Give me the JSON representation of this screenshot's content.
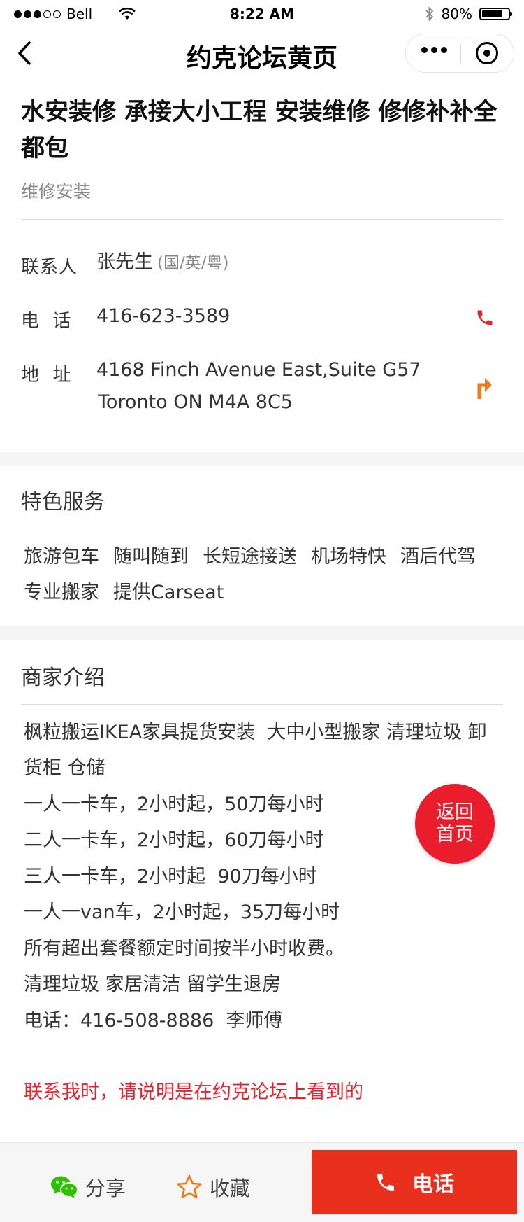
{
  "status_bar": {
    "carrier": "Bell",
    "time": "8:22 AM",
    "battery_text": "80%",
    "battery_level": 0.8
  },
  "nav": {
    "title": "约克论坛黄页"
  },
  "business": {
    "title": "水安装修 承接大小工程 安装维修 修修补补全都包",
    "category": "维修安装",
    "contact_label": "联系人",
    "contact_name": "张先生",
    "contact_languages": "(国/英/粤)",
    "phone_label": "电  话",
    "phone": "416-623-3589",
    "address_label": "地  址",
    "address_line1": "4168 Finch Avenue East,Suite G57",
    "address_line2": "Toronto ON M4A 8C5"
  },
  "services": {
    "title": "特色服务",
    "tags": [
      "旅游包车",
      "随叫随到",
      "长短途接送",
      "机场特快",
      "酒后代驾",
      "专业搬家",
      "提供Carseat"
    ]
  },
  "intro": {
    "title": "商家介绍",
    "lines": [
      "枫粒搬运IKEA家具提货安装  大中小型搬家 清理垃圾 卸",
      "货柜 仓储",
      "一人一卡车，2小时起，50刀每小时",
      "二人一卡车，2小时起，60刀每小时",
      "三人一卡车，2小时起  90刀每小时",
      "一人一van车，2小时起，35刀每小时",
      "所有超出套餐额定时间按半小时收费。",
      "清理垃圾 家居清洁 留学生退房",
      "电话：416-508-8886  李师傅"
    ],
    "notice": "联系我时，请说明是在约克论坛上看到的"
  },
  "home_button": {
    "line1": "返回",
    "line2": "首页"
  },
  "bottom_bar": {
    "share_label": "分享",
    "favorite_label": "收藏",
    "call_label": "电话"
  },
  "colors": {
    "accent_red": "#e8301c",
    "notice_red": "#e8222d",
    "wechat_green": "#2dc100",
    "nav_orange": "#f07a1a"
  }
}
